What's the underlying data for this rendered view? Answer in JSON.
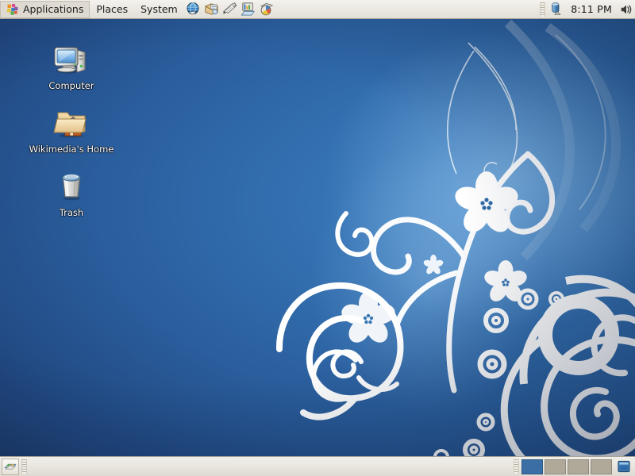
{
  "desktop": {
    "environment": "GNOME",
    "wallpaper_theme": "blue-floral-swirl",
    "colors": {
      "wall_dark": "#1a3763",
      "wall_mid": "#2c6099",
      "wall_light": "#3f82c4",
      "panel_bg": "#ece9e3",
      "panel_text": "#1c1c1c",
      "workspace_active": "#3a6ea5",
      "workspace_inactive": "#b0a99a",
      "icon_label": "#ffffff"
    }
  },
  "top_panel": {
    "menus": [
      {
        "label": "Applications",
        "icon": "gnome-logo-icon"
      },
      {
        "label": "Places",
        "icon": ""
      },
      {
        "label": "System",
        "icon": ""
      }
    ],
    "launchers": [
      {
        "name": "web-browser-icon",
        "tooltip": "Web Browser"
      },
      {
        "name": "email-client-icon",
        "tooltip": "Email"
      },
      {
        "name": "word-processor-icon",
        "tooltip": "Word Processor"
      },
      {
        "name": "spreadsheet-icon",
        "tooltip": "Spreadsheet"
      },
      {
        "name": "presentation-icon",
        "tooltip": "Presentation"
      }
    ],
    "tray": {
      "drive_applet": "removable-drive-icon",
      "clock": "8:11 PM",
      "volume": "volume-speaker-icon"
    }
  },
  "desktop_icons": [
    {
      "id": "computer",
      "label": "Computer",
      "icon": "computer-icon"
    },
    {
      "id": "home",
      "label": "Wikimedia's Home",
      "icon": "home-folder-icon"
    },
    {
      "id": "trash",
      "label": "Trash",
      "icon": "trash-icon"
    }
  ],
  "bottom_panel": {
    "show_desktop_tooltip": "Show Desktop",
    "window_list": [],
    "workspaces": [
      {
        "index": 1,
        "active": true
      },
      {
        "index": 2,
        "active": false
      },
      {
        "index": 3,
        "active": false
      },
      {
        "index": 4,
        "active": false
      }
    ],
    "trash_applet": "window-applet-icon"
  }
}
